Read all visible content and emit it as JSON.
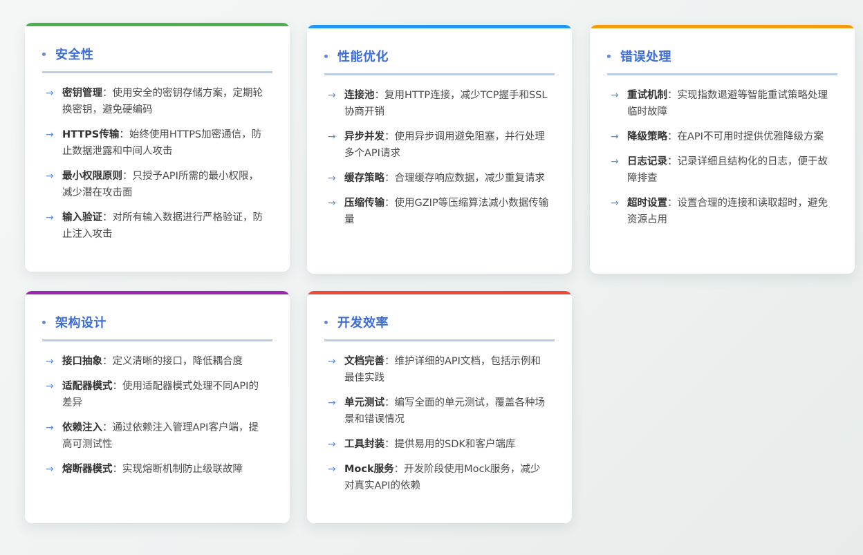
{
  "cards": [
    {
      "title": "安全性",
      "accent": "#4caf50",
      "items": [
        {
          "title": "密钥管理",
          "sep": "：",
          "desc": "使用安全的密钥存储方案，定期轮换密钥，避免硬编码"
        },
        {
          "title": "HTTPS传输",
          "sep": "：",
          "desc": "始终使用HTTPS加密通信，防止数据泄露和中间人攻击"
        },
        {
          "title": "最小权限原则",
          "sep": "：",
          "desc": "只授予API所需的最小权限，减少潜在攻击面"
        },
        {
          "title": "输入验证",
          "sep": "：",
          "desc": "对所有输入数据进行严格验证，防止注入攻击"
        }
      ]
    },
    {
      "title": "性能优化",
      "accent": "#2196f3",
      "items": [
        {
          "title": "连接池",
          "sep": "：",
          "desc": "复用HTTP连接，减少TCP握手和SSL协商开销"
        },
        {
          "title": "异步并发",
          "sep": "：",
          "desc": "使用异步调用避免阻塞，并行处理多个API请求"
        },
        {
          "title": "缓存策略",
          "sep": "：",
          "desc": "合理缓存响应数据，减少重复请求"
        },
        {
          "title": "压缩传输",
          "sep": "：",
          "desc": "使用GZIP等压缩算法减小数据传输量"
        }
      ]
    },
    {
      "title": "错误处理",
      "accent": "#f39c12",
      "items": [
        {
          "title": "重试机制",
          "sep": "：",
          "desc": "实现指数退避等智能重试策略处理临时故障"
        },
        {
          "title": "降级策略",
          "sep": "：",
          "desc": "在API不可用时提供优雅降级方案"
        },
        {
          "title": "日志记录",
          "sep": "：",
          "desc": "记录详细且结构化的日志，便于故障排查"
        },
        {
          "title": "超时设置",
          "sep": "：",
          "desc": "设置合理的连接和读取超时，避免资源占用"
        }
      ]
    },
    {
      "title": "架构设计",
      "accent": "#9c27b0",
      "items": [
        {
          "title": "接口抽象",
          "sep": "：",
          "desc": "定义清晰的接口，降低耦合度"
        },
        {
          "title": "适配器模式",
          "sep": "：",
          "desc": "使用适配器模式处理不同API的差异"
        },
        {
          "title": "依赖注入",
          "sep": "：",
          "desc": "通过依赖注入管理API客户端，提高可测试性"
        },
        {
          "title": "熔断器模式",
          "sep": "：",
          "desc": "实现熔断机制防止级联故障"
        }
      ]
    },
    {
      "title": "开发效率",
      "accent": "#e74c3c",
      "items": [
        {
          "title": "文档完善",
          "sep": "：",
          "desc": "维护详细的API文档，包括示例和最佳实践"
        },
        {
          "title": "单元测试",
          "sep": "：",
          "desc": "编写全面的单元测试，覆盖各种场景和错误情况"
        },
        {
          "title": "工具封装",
          "sep": "：",
          "desc": "提供易用的SDK和客户端库"
        },
        {
          "title": "Mock服务",
          "sep": "：",
          "desc": "开发阶段使用Mock服务，减少对真实API的依赖"
        }
      ]
    }
  ]
}
